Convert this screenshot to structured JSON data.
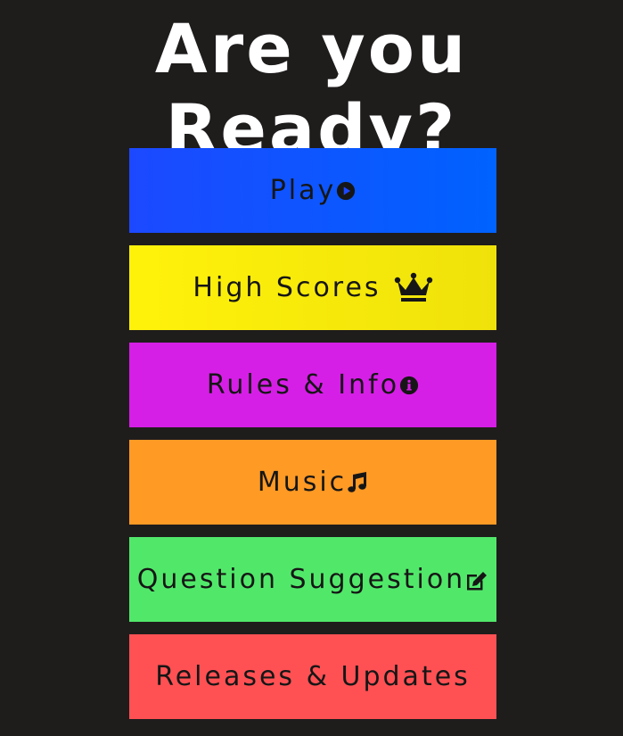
{
  "title": "Are you Ready?",
  "menu": {
    "play": {
      "label": "Play",
      "icon": "play-circle-icon",
      "color": "#1c49ff"
    },
    "high_scores": {
      "label": "High Scores",
      "icon": "crown-icon",
      "color": "#fff20a"
    },
    "rules": {
      "label": "Rules & Info",
      "icon": "info-circle-icon",
      "color": "#d61fe6"
    },
    "music": {
      "label": "Music",
      "icon": "music-note-icon",
      "color": "#ff9a25"
    },
    "suggestion": {
      "label": "Question Suggestion",
      "icon": "edit-icon",
      "color": "#51e86a"
    },
    "releases": {
      "label": "Releases & Updates",
      "color": "#ff5154"
    }
  },
  "colors": {
    "background": "#1f1c1c",
    "title_text": "#ffffff",
    "button_text": "#161616"
  }
}
